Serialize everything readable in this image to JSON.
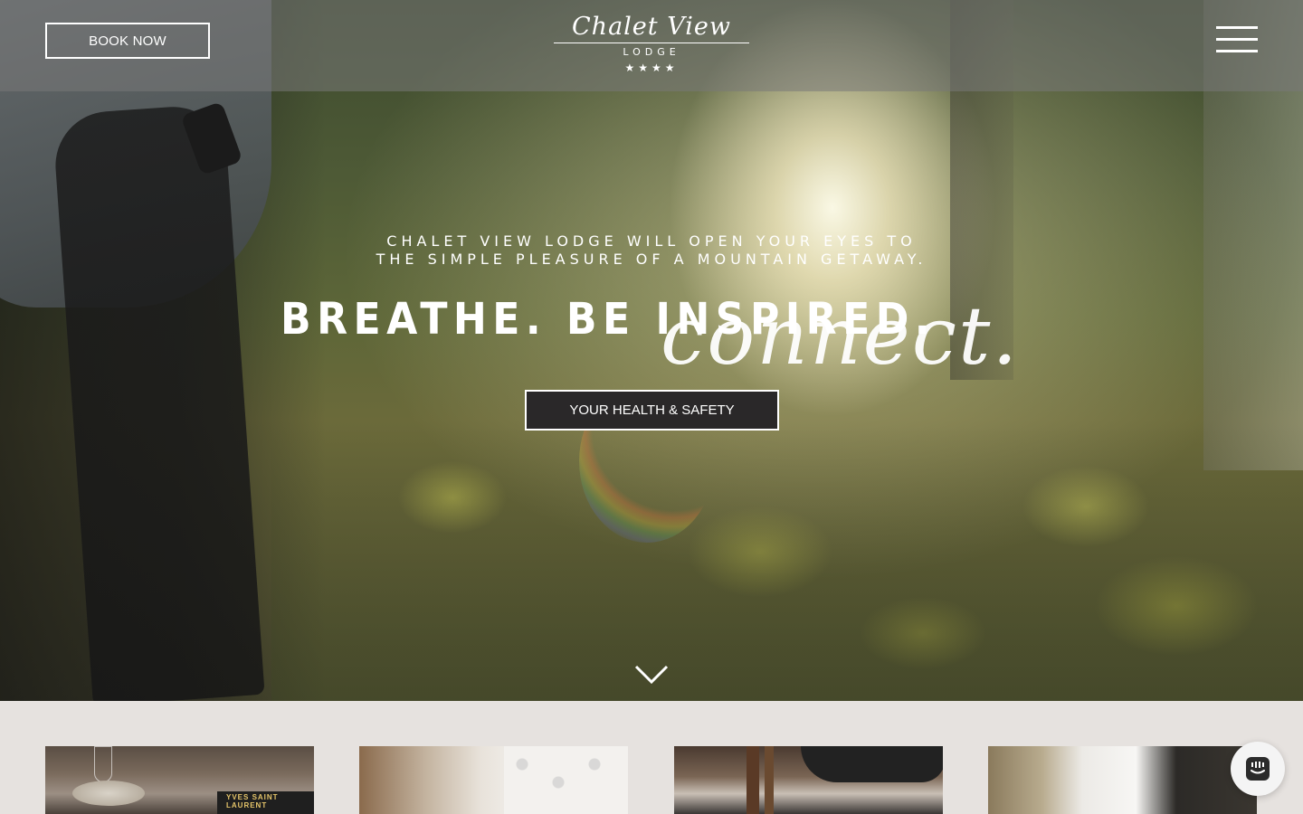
{
  "header": {
    "book_label": "BOOK NOW",
    "logo": {
      "name": "Chalet View",
      "sub": "LODGE",
      "stars": "★★★★"
    },
    "menu_icon": "hamburger-menu-icon"
  },
  "hero": {
    "tagline_line1": "CHALET VIEW LODGE WILL OPEN YOUR EYES TO",
    "tagline_line2": "THE SIMPLE PLEASURE OF A MOUNTAIN GETAWAY.",
    "headline": "BREATHE. BE INSPIRED.",
    "script_word": "connect.",
    "cta_label": "YOUR HEALTH & SAFETY",
    "scroll_icon": "chevron-down-icon"
  },
  "cards": [
    {
      "name": "lounge-photo",
      "text": "YVES SAINT LAURENT"
    },
    {
      "name": "bedroom-photo"
    },
    {
      "name": "dining-photo"
    },
    {
      "name": "wedding-photo"
    }
  ],
  "chat": {
    "icon": "chat-icon"
  },
  "colors": {
    "button_dark": "#2a2829",
    "section_bg": "#e6e2df",
    "text": "#ffffff"
  }
}
